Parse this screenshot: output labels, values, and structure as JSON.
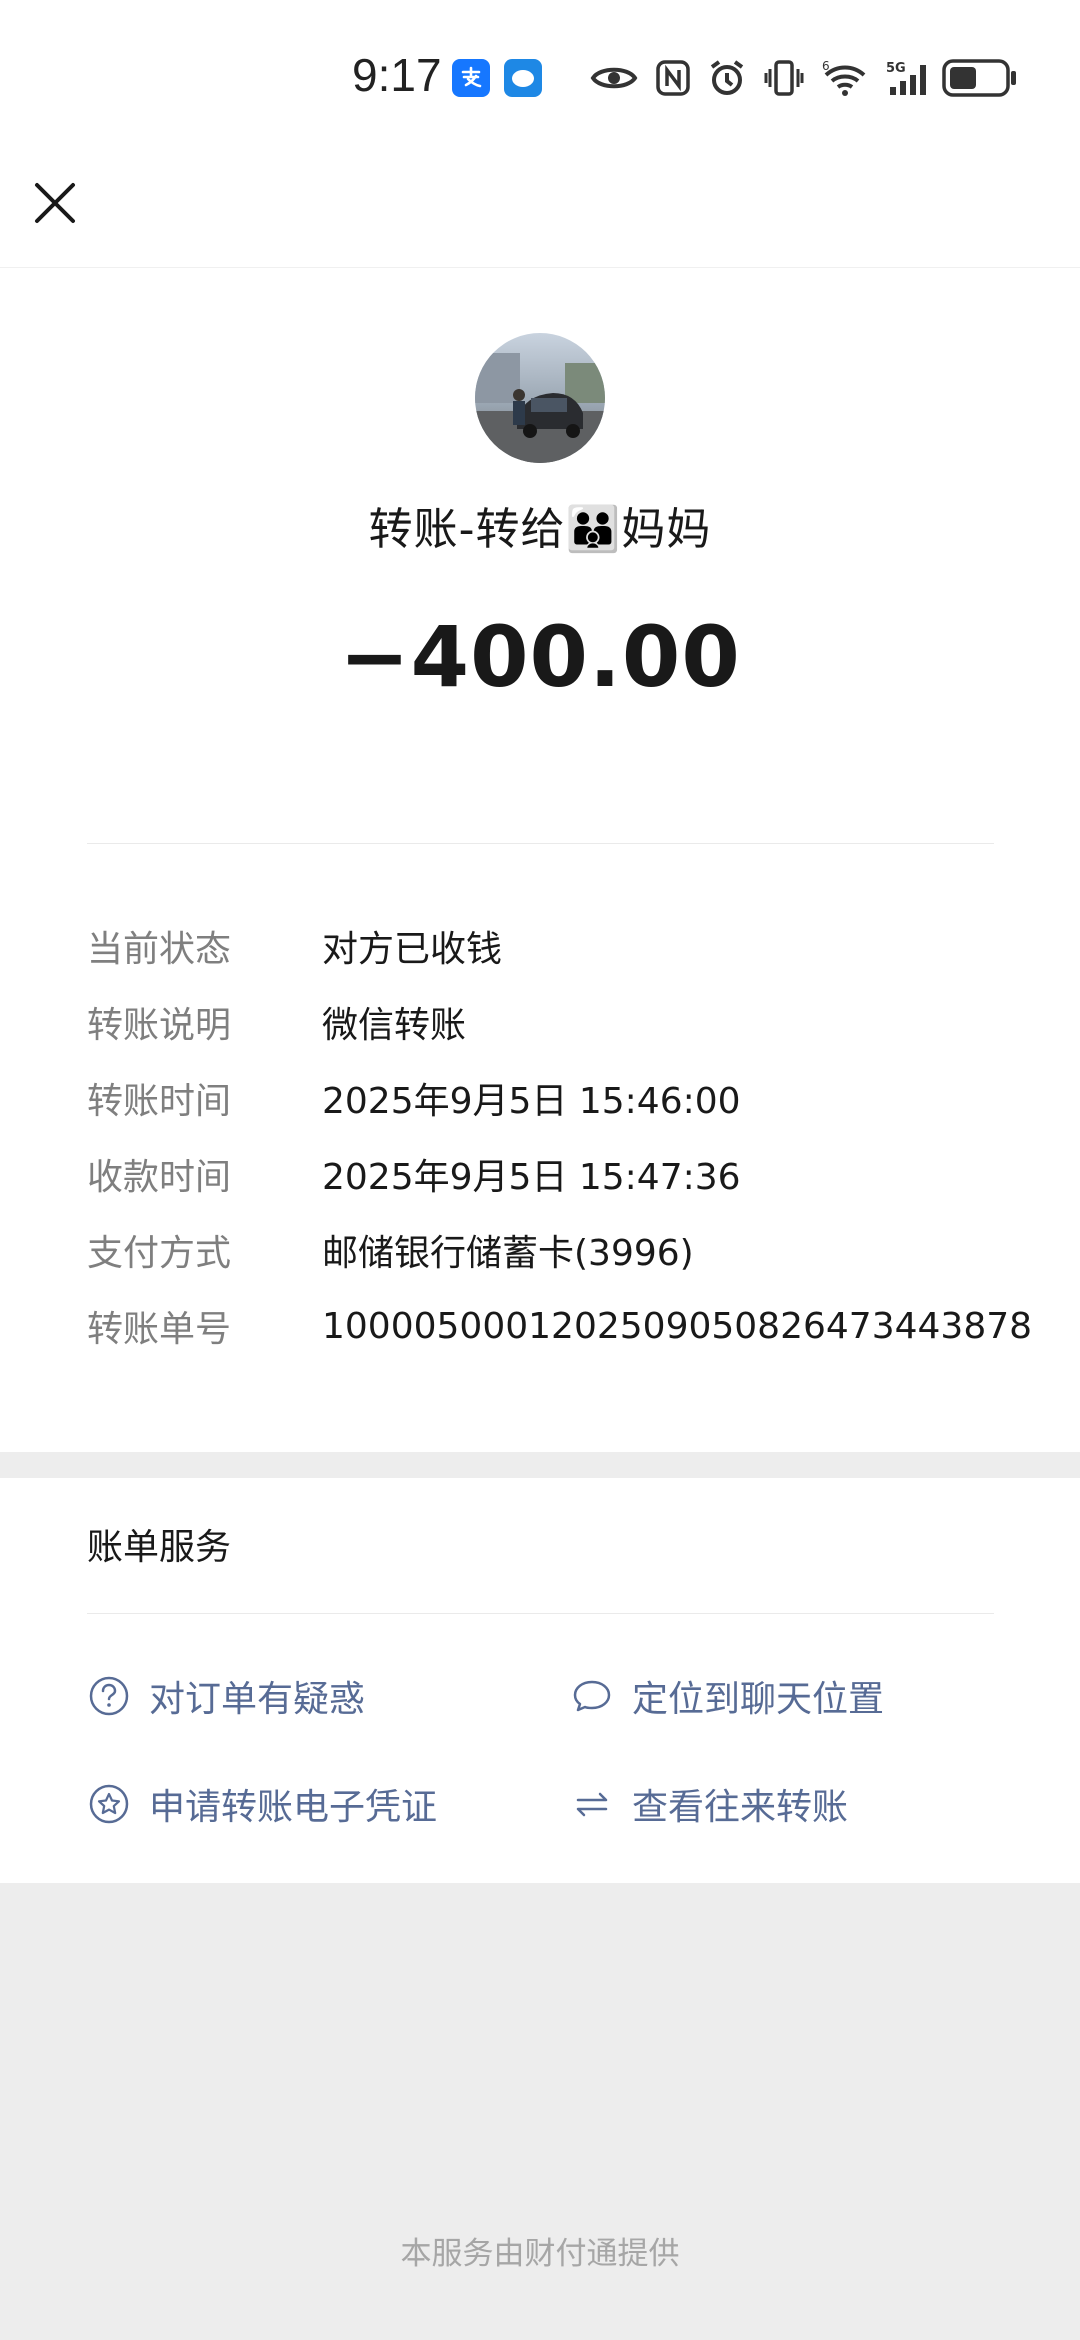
{
  "status_bar": {
    "time": "9:17",
    "app_icons": [
      "alipay-icon",
      "message-icon"
    ],
    "system_icons": [
      "eye-icon",
      "nfc-icon",
      "alarm-icon",
      "vibrate-icon",
      "wifi-icon",
      "signal-5g-icon",
      "battery-icon"
    ]
  },
  "nav": {
    "close_icon": "close-icon"
  },
  "transfer": {
    "title": "转账-转给👪妈妈",
    "amount": "−400.00"
  },
  "details": [
    {
      "label": "当前状态",
      "value": "对方已收钱"
    },
    {
      "label": "转账说明",
      "value": "微信转账"
    },
    {
      "label": "转账时间",
      "value": "2025年9月5日 15:46:00"
    },
    {
      "label": "收款时间",
      "value": "2025年9月5日 15:47:36"
    },
    {
      "label": "支付方式",
      "value": "邮储银行储蓄卡(3996)"
    },
    {
      "label": "转账单号",
      "value": "1000050001202509050826473443878"
    }
  ],
  "services": {
    "title": "账单服务",
    "items": [
      {
        "label": "对订单有疑惑",
        "icon": "question-icon"
      },
      {
        "label": "定位到聊天位置",
        "icon": "chat-bubble-icon"
      },
      {
        "label": "申请转账电子凭证",
        "icon": "star-badge-icon"
      },
      {
        "label": "查看往来转账",
        "icon": "exchange-arrows-icon"
      }
    ]
  },
  "footer": "本服务由财付通提供",
  "colors": {
    "link": "#576b95",
    "label": "#7f7f7f",
    "background": "#ededed"
  }
}
